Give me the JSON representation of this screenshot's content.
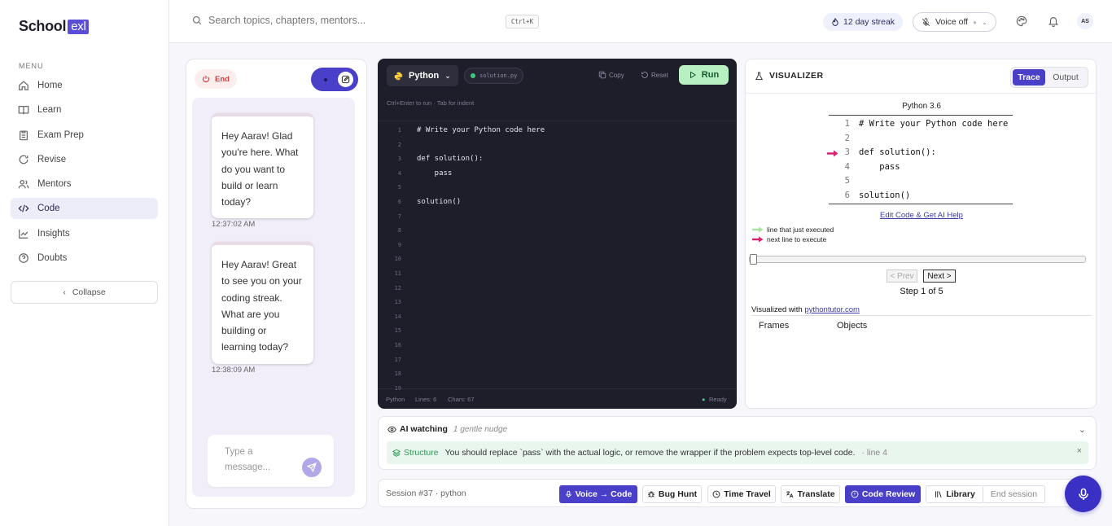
{
  "brand": {
    "name": "School",
    "badge": "exl"
  },
  "sidebar": {
    "menu_label": "MENU",
    "items": [
      {
        "label": "Home",
        "icon": "home-icon"
      },
      {
        "label": "Learn",
        "icon": "book-icon"
      },
      {
        "label": "Exam Prep",
        "icon": "clipboard-icon"
      },
      {
        "label": "Revise",
        "icon": "refresh-icon"
      },
      {
        "label": "Mentors",
        "icon": "users-icon"
      },
      {
        "label": "Code",
        "icon": "code-icon",
        "active": true
      },
      {
        "label": "Insights",
        "icon": "chart-icon"
      },
      {
        "label": "Doubts",
        "icon": "help-icon"
      }
    ],
    "collapse_label": "Collapse"
  },
  "topbar": {
    "search_placeholder": "Search topics, chapters, mentors...",
    "shortcut": "Ctrl+K",
    "streak": "12 day streak",
    "voice": "Voice off",
    "avatar": "AS"
  },
  "chat": {
    "end_label": "End",
    "messages": [
      {
        "text": "Hey Aarav! Glad you're here. What do you want to build or learn today?",
        "time": "12:37:02 AM"
      },
      {
        "text": "Hey Aarav! Great to see you on your coding streak. What are you building or learning today?",
        "time": "12:38:09 AM"
      }
    ],
    "input_placeholder": "Type a message..."
  },
  "editor": {
    "language": "Python",
    "filename": "solution.py",
    "copy_label": "Copy",
    "reset_label": "Reset",
    "run_label": "Run",
    "hint": "Ctrl+Enter to run · Tab for indent",
    "line_numbers": [
      "1",
      "2",
      "3",
      "4",
      "5",
      "6",
      "7",
      "8",
      "9",
      "10",
      "11",
      "12",
      "13",
      "14",
      "15",
      "16",
      "17",
      "18",
      "19"
    ],
    "code_lines": [
      "# Write your Python code here",
      "",
      "def solution():",
      "    pass",
      "",
      "solution()"
    ],
    "footer": {
      "lang": "Python",
      "lines": "Lines: 6",
      "chars": "Chars: 67",
      "status": "Ready"
    }
  },
  "visualizer": {
    "title": "VISUALIZER",
    "tab_trace": "Trace",
    "tab_output": "Output",
    "python_version": "Python 3.6",
    "trace_lines": [
      {
        "n": "1",
        "text": "# Write your Python code here"
      },
      {
        "n": "2",
        "text": ""
      },
      {
        "n": "3",
        "text": "def solution():",
        "arrow": true
      },
      {
        "n": "4",
        "text": "    pass"
      },
      {
        "n": "5",
        "text": ""
      },
      {
        "n": "6",
        "text": "solution()"
      }
    ],
    "edit_link": "Edit Code & Get AI Help",
    "legend_executed": "line that just executed",
    "legend_next": "next line to execute",
    "prev_label": "< Prev",
    "next_label": "Next >",
    "step_text": "Step 1 of 5",
    "visualized_with": "Visualized with",
    "visualized_link": "pythontutor.com",
    "frames_label": "Frames",
    "objects_label": "Objects",
    "colors": {
      "executed": "#a6e3a1",
      "next": "#d6246e"
    }
  },
  "ai_watch": {
    "title": "AI watching",
    "subtitle": "1 gentle nudge",
    "nudge_tag": "Structure",
    "nudge_text": "You should replace `pass` with the actual logic, or remove the wrapper if the problem expects top-level code.",
    "nudge_line": "· line 4"
  },
  "toolbar": {
    "session": "Session #37 · python",
    "buttons": [
      "Voice → Code",
      "Bug Hunt",
      "Time Travel",
      "Translate",
      "Code Review",
      "Library"
    ],
    "end_session": "End session"
  }
}
